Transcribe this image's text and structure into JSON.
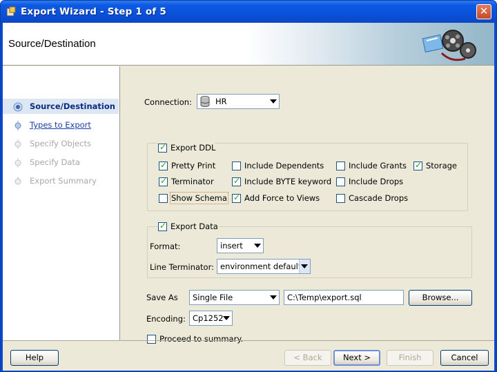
{
  "window": {
    "title": "Export Wizard - Step 1 of 5",
    "close_glyph": "✕"
  },
  "header": {
    "page_title": "Source/Destination"
  },
  "steps": [
    {
      "label": "Source/Destination",
      "state": "current"
    },
    {
      "label": "Types to Export",
      "state": "link"
    },
    {
      "label": "Specify Objects",
      "state": "disabled"
    },
    {
      "label": "Specify Data",
      "state": "disabled"
    },
    {
      "label": "Export Summary",
      "state": "disabled"
    }
  ],
  "connection": {
    "label": "Connection:",
    "value": "HR",
    "icon": "database-icon"
  },
  "export_ddl": {
    "label": "Export DDL",
    "checked": true,
    "options": {
      "pretty_print": {
        "label": "Pretty Print",
        "checked": true
      },
      "include_dependents": {
        "label": "Include Dependents",
        "checked": false
      },
      "include_grants": {
        "label": "Include Grants",
        "checked": false
      },
      "storage": {
        "label": "Storage",
        "checked": true
      },
      "terminator": {
        "label": "Terminator",
        "checked": true
      },
      "include_byte_keyword": {
        "label": "Include BYTE keyword",
        "checked": true
      },
      "include_drops": {
        "label": "Include Drops",
        "checked": false
      },
      "show_schema": {
        "label": "Show Schema",
        "checked": false
      },
      "add_force_to_views": {
        "label": "Add Force to Views",
        "checked": true
      },
      "cascade_drops": {
        "label": "Cascade Drops",
        "checked": false
      }
    }
  },
  "export_data": {
    "label": "Export Data",
    "checked": true,
    "format_label": "Format:",
    "format_value": "insert",
    "line_terminator_label": "Line Terminator:",
    "line_terminator_value": "environment default"
  },
  "save_as": {
    "label": "Save As",
    "mode_value": "Single File",
    "path_value": "C:\\Temp\\export.sql",
    "browse_label": "Browse..."
  },
  "encoding": {
    "label": "Encoding:",
    "value": "Cp1252"
  },
  "proceed_to_summary": {
    "label": "Proceed to summary.",
    "checked": false
  },
  "buttons": {
    "help": "Help",
    "back": "< Back",
    "next": "Next >",
    "finish": "Finish",
    "cancel": "Cancel"
  },
  "colors": {
    "titlebar": "#0a4fd6",
    "dialog_bg": "#ece9d8",
    "current_step": "#0a2b80",
    "check_tick": "#21a121"
  }
}
